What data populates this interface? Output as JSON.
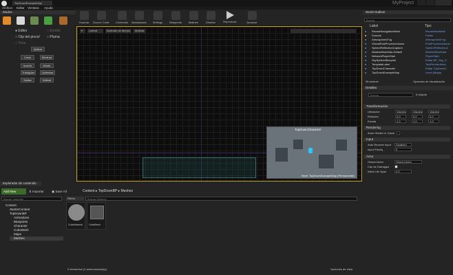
{
  "titlebar": {
    "tab": "TopDownExampleMap",
    "project": "MyProject"
  },
  "menu": [
    "Archivo",
    "Editar",
    "Ventana",
    "Ayuda"
  ],
  "modes": {
    "title": "Modos",
    "radios": [
      {
        "label": "Editor"
      },
      {
        "label": "Estrido"
      },
      {
        "label": "Clip del pincel"
      },
      {
        "label": "Pluma"
      },
      {
        "label": "Tinta"
      }
    ],
    "apply": "Aplicar",
    "buttons": [
      "Crear",
      "Eliminar",
      "Invertir",
      "Dividir",
      "Triangular",
      "Optimizar",
      "Soldar",
      "Voltear"
    ]
  },
  "toolbar": [
    "Guardar",
    "Source Control",
    "Contenido",
    "Marketplace",
    "Settings",
    "Blueprints",
    "Matinee",
    "Diseñar",
    "Reproducir",
    "Arrancar"
  ],
  "viewport": {
    "persp": "Lateral",
    "lit": "Ilustrado de tiempo",
    "show": "Mostrar",
    "preview_title": "TopDownCharacter",
    "level_label": "Nivel: TopDownExampleMap (Permanente)"
  },
  "outliner": {
    "title": "World Outliner",
    "search_placeholder": "Buscar",
    "col_label": "Label",
    "col_type": "Tipo",
    "rows": [
      {
        "n": "RecastNavigationMesh",
        "t": "RecastNavMesh"
      },
      {
        "n": "Sounds",
        "t": "Folder"
      },
      {
        "n": "AtmosphericFog",
        "t": "AtmosphericFog"
      },
      {
        "n": "GlobalPostProcessVolume",
        "t": "PostProcessVolume"
      },
      {
        "n": "SphereReflectionCapture",
        "t": "SphereReflectionC"
      },
      {
        "n": "AbstractNavData-Default",
        "t": "AbstractNavData"
      },
      {
        "n": "NetworkPlayerStart",
        "t": "PlayerStart"
      },
      {
        "n": "SkySphereBlueprint",
        "t": "Editar BP_Sky_S"
      },
      {
        "n": "TemplateLabel",
        "t": "TextRenderActor"
      },
      {
        "n": "TopDownCharacter",
        "t": "Editar TopDownC"
      },
      {
        "n": "TopDownExampleMap",
        "t": "Level (Mapa)"
      }
    ],
    "count": "36 actores",
    "view_options": "Opciones de visualización"
  },
  "details": {
    "title": "Detalles",
    "search_placeholder": "Buscar",
    "selection": "5 objects",
    "transform": {
      "title": "Transformación",
      "location": "Ubicación",
      "rotation": "Rotación",
      "scale": "Escala",
      "values": "Valores",
      "val0": "0.0",
      "val1": "1.0"
    },
    "rendering": {
      "title": "Rendering",
      "hidden": "Actor Hidden in Game"
    },
    "input": {
      "title": "Input",
      "auto": "Auto Receive Input",
      "auto_val": "Disabled",
      "priority": "Input Priority",
      "priority_val": "0"
    },
    "actor": {
      "title": "Actor",
      "owner": "Owned Actor",
      "owner_val": "Owned Actor",
      "can_damage": "Can be Damaged",
      "lifespan": "Initial Life Span",
      "lifespan_val": "0.0"
    }
  },
  "content": {
    "title": "Explorador de contenido",
    "add": "Add New",
    "import": "Importar",
    "save": "Save All",
    "path": [
      "Content",
      "TopDownBP",
      "Meshes"
    ],
    "search": "Buscar carpetas",
    "filters": "Filtros",
    "search_assets": "Buscar Meshes",
    "tree": [
      "Content",
      "StarterContent",
      "TopDownBP",
      "Animations",
      "Blueprints",
      "Character",
      "CubeMesh",
      "Maps",
      "Meshes"
    ],
    "assets": [
      {
        "name": "CubeMaterial"
      },
      {
        "name": "CubeMesh"
      }
    ],
    "status": "2 elementos (1 seleccionado(s))",
    "view": "Opciones de vista"
  }
}
